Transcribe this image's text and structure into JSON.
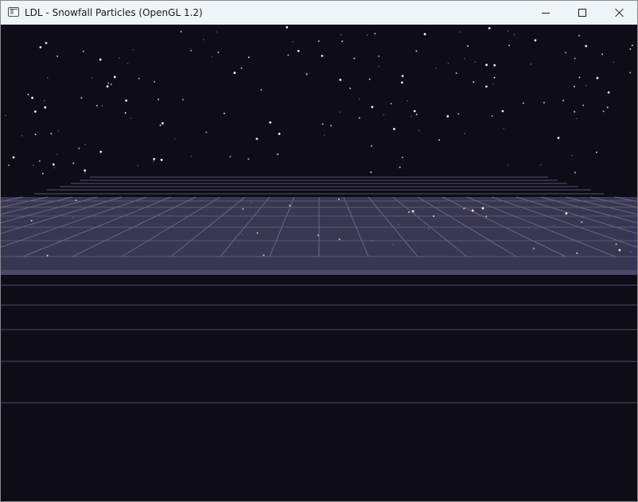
{
  "window": {
    "title": "LDL - Snowfall Particles (OpenGL 1.2)",
    "icon": "app-window-icon",
    "controls": [
      "minimize-icon",
      "maximize-icon",
      "close-icon"
    ]
  },
  "scene": {
    "background_color": "#0d0c17",
    "floor_color": "#393652",
    "grid_color": "#6a6784",
    "horizon_line_color": "#55536c",
    "snow_color": "#ffffff"
  }
}
